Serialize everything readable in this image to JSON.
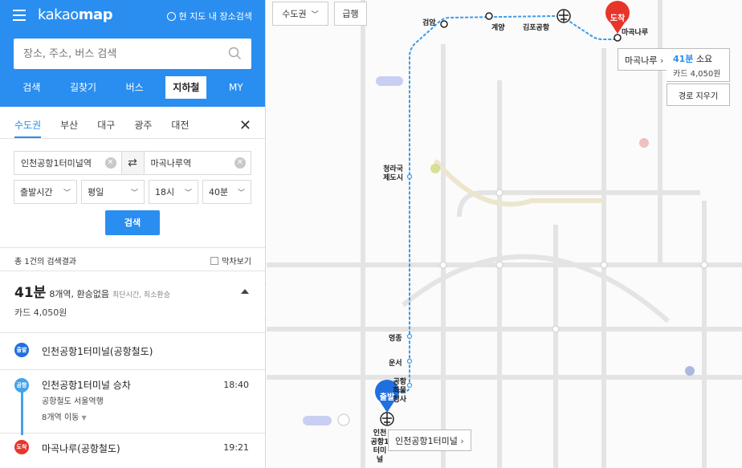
{
  "app": {
    "logo_light": "kakao",
    "logo_bold": "map",
    "area_search": "현 지도 내 장소검색"
  },
  "search": {
    "placeholder": "장소, 주소, 버스 검색"
  },
  "main_tabs": [
    "검색",
    "길찾기",
    "버스",
    "지하철",
    "MY"
  ],
  "region_tabs": [
    "수도권",
    "부산",
    "대구",
    "광주",
    "대전"
  ],
  "route": {
    "origin": "인천공항1터미널역",
    "destination": "마곡나루역",
    "selects": [
      "출발시간",
      "평일",
      "18시",
      "40분"
    ],
    "search_button": "검색"
  },
  "results": {
    "count_text": "총 1건의 검색결과",
    "line_view": "막차보기",
    "time": "41분",
    "desc": "8개역, 환승없음",
    "sub": "최단시간, 최소환승",
    "fare": "카드 4,050원"
  },
  "steps": {
    "depart_badge": "출발",
    "depart_name": "인천공항1터미널(공항철도)",
    "board_badge": "공항",
    "board_title": "인천공항1터미널 승차",
    "board_time": "18:40",
    "board_line": "공항철도 서울역행",
    "board_stops": "8개역 이동",
    "arrive_badge": "도착",
    "arrive_name": "마곡나루(공항철도)",
    "arrive_time": "19:21"
  },
  "map": {
    "ctrl_region": "수도권",
    "ctrl_express": "급행",
    "arrival_pin": "도착",
    "departure_pin": "출발",
    "dest_popup_name": "마곡나루",
    "dest_popup_time": "41분",
    "dest_popup_time_suffix": "소요",
    "dest_popup_fare": "카드 4,050원",
    "clear_route": "경로 지우기",
    "origin_popup": "인천공항1터미널",
    "stations": [
      {
        "name": "검암"
      },
      {
        "name": "계양"
      },
      {
        "name": "김포공항"
      },
      {
        "name": "마곡나루"
      },
      {
        "name": "청라국제도시"
      },
      {
        "name": "영종"
      },
      {
        "name": "운서"
      },
      {
        "name": "공항화물청사"
      },
      {
        "name": "인천공항1터미널"
      }
    ]
  },
  "colors": {
    "brand": "#2a8ef0",
    "route": "#3d9be9",
    "pin": "#e8352a"
  }
}
